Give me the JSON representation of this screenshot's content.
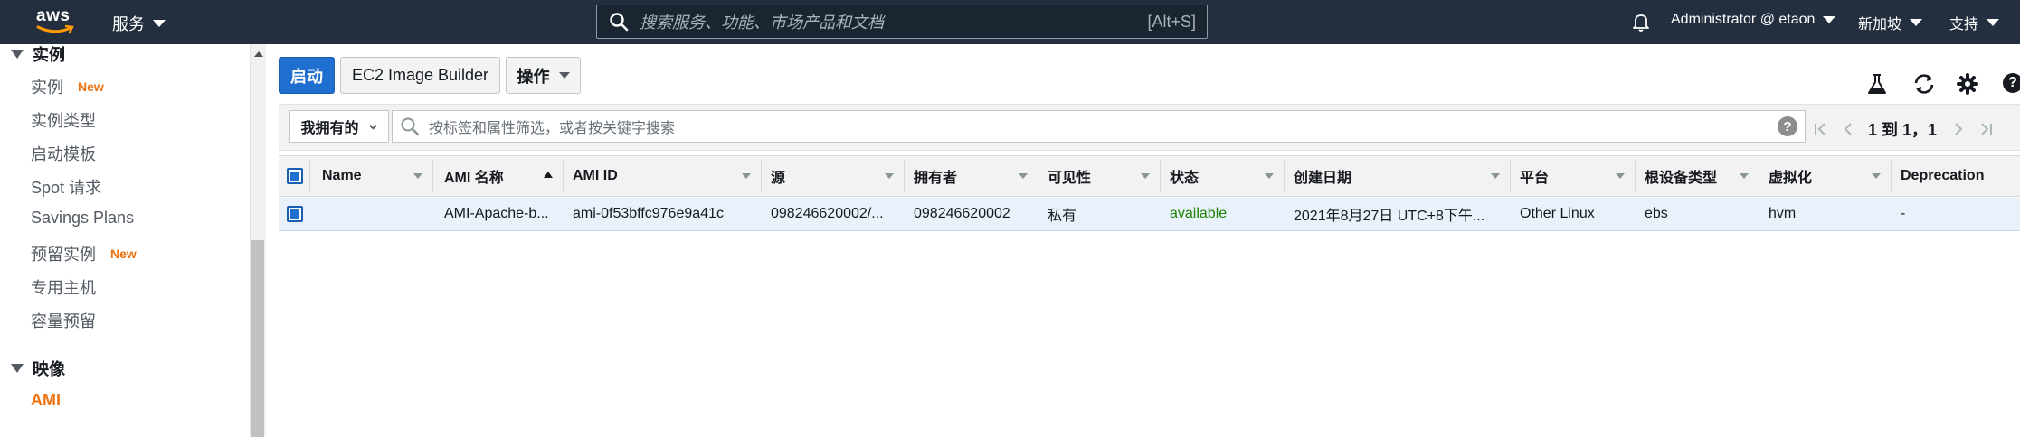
{
  "nav": {
    "logo_text": "aws",
    "services_label": "服务",
    "search_placeholder": "搜索服务、功能、市场产品和文档",
    "search_shortcut": "[Alt+S]",
    "account_label": "Administrator @ etaon",
    "region_label": "新加坡",
    "support_label": "支持",
    "icons": [
      "bell-icon",
      "search-icon",
      "caret-down-icon"
    ]
  },
  "sidebar": {
    "section_instances": "实例",
    "items_instances": [
      {
        "label": "实例",
        "badge": "New"
      },
      {
        "label": "实例类型"
      },
      {
        "label": "启动模板"
      },
      {
        "label": "Spot 请求"
      },
      {
        "label": "Savings Plans"
      },
      {
        "label": "预留实例",
        "badge": "New"
      },
      {
        "label": "专用主机"
      },
      {
        "label": "容量预留"
      }
    ],
    "section_images": "映像",
    "items_images": [
      {
        "label": "AMI",
        "active": true
      }
    ]
  },
  "toolbar": {
    "launch_label": "启动",
    "image_builder_label": "EC2 Image Builder",
    "actions_label": "操作",
    "icons": [
      "flask-icon",
      "refresh-icon",
      "gear-icon",
      "help-icon"
    ]
  },
  "filter": {
    "owner_label": "我拥有的",
    "placeholder": "按标签和属性筛选，或者按关键字搜索",
    "pagination_text": "1 到 1，1"
  },
  "table": {
    "columns": [
      "Name",
      "AMI 名称",
      "AMI ID",
      "源",
      "拥有者",
      "可见性",
      "状态",
      "创建日期",
      "平台",
      "根设备类型",
      "虚拟化",
      "Deprecation"
    ],
    "sorted_column": "AMI 名称",
    "rows": [
      {
        "name": "",
        "ami_name": "AMI-Apache-b...",
        "ami_id": "ami-0f53bffc976e9a41c",
        "source": "098246620002/...",
        "owner": "098246620002",
        "visibility": "私有",
        "status": "available",
        "created": "2021年8月27日 UTC+8下午...",
        "platform": "Other Linux",
        "root_device": "ebs",
        "virtualization": "hvm",
        "deprecation": "-"
      }
    ]
  },
  "colors": {
    "nav_bg": "#232f3e",
    "primary": "#1f6fd0",
    "accent": "#ec7211",
    "status_green": "#1d8102"
  }
}
